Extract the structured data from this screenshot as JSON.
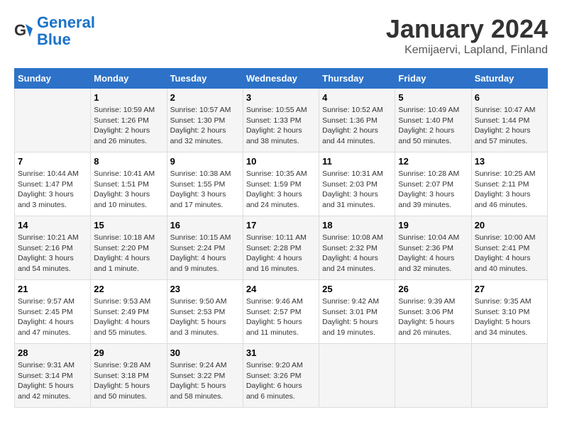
{
  "header": {
    "logo_general": "General",
    "logo_blue": "Blue",
    "main_title": "January 2024",
    "subtitle": "Kemijaervi, Lapland, Finland"
  },
  "weekdays": [
    "Sunday",
    "Monday",
    "Tuesday",
    "Wednesday",
    "Thursday",
    "Friday",
    "Saturday"
  ],
  "weeks": [
    [
      {
        "day": "",
        "info": ""
      },
      {
        "day": "1",
        "info": "Sunrise: 10:59 AM\nSunset: 1:26 PM\nDaylight: 2 hours\nand 26 minutes."
      },
      {
        "day": "2",
        "info": "Sunrise: 10:57 AM\nSunset: 1:30 PM\nDaylight: 2 hours\nand 32 minutes."
      },
      {
        "day": "3",
        "info": "Sunrise: 10:55 AM\nSunset: 1:33 PM\nDaylight: 2 hours\nand 38 minutes."
      },
      {
        "day": "4",
        "info": "Sunrise: 10:52 AM\nSunset: 1:36 PM\nDaylight: 2 hours\nand 44 minutes."
      },
      {
        "day": "5",
        "info": "Sunrise: 10:49 AM\nSunset: 1:40 PM\nDaylight: 2 hours\nand 50 minutes."
      },
      {
        "day": "6",
        "info": "Sunrise: 10:47 AM\nSunset: 1:44 PM\nDaylight: 2 hours\nand 57 minutes."
      }
    ],
    [
      {
        "day": "7",
        "info": "Sunrise: 10:44 AM\nSunset: 1:47 PM\nDaylight: 3 hours\nand 3 minutes."
      },
      {
        "day": "8",
        "info": "Sunrise: 10:41 AM\nSunset: 1:51 PM\nDaylight: 3 hours\nand 10 minutes."
      },
      {
        "day": "9",
        "info": "Sunrise: 10:38 AM\nSunset: 1:55 PM\nDaylight: 3 hours\nand 17 minutes."
      },
      {
        "day": "10",
        "info": "Sunrise: 10:35 AM\nSunset: 1:59 PM\nDaylight: 3 hours\nand 24 minutes."
      },
      {
        "day": "11",
        "info": "Sunrise: 10:31 AM\nSunset: 2:03 PM\nDaylight: 3 hours\nand 31 minutes."
      },
      {
        "day": "12",
        "info": "Sunrise: 10:28 AM\nSunset: 2:07 PM\nDaylight: 3 hours\nand 39 minutes."
      },
      {
        "day": "13",
        "info": "Sunrise: 10:25 AM\nSunset: 2:11 PM\nDaylight: 3 hours\nand 46 minutes."
      }
    ],
    [
      {
        "day": "14",
        "info": "Sunrise: 10:21 AM\nSunset: 2:16 PM\nDaylight: 3 hours\nand 54 minutes."
      },
      {
        "day": "15",
        "info": "Sunrise: 10:18 AM\nSunset: 2:20 PM\nDaylight: 4 hours\nand 1 minute."
      },
      {
        "day": "16",
        "info": "Sunrise: 10:15 AM\nSunset: 2:24 PM\nDaylight: 4 hours\nand 9 minutes."
      },
      {
        "day": "17",
        "info": "Sunrise: 10:11 AM\nSunset: 2:28 PM\nDaylight: 4 hours\nand 16 minutes."
      },
      {
        "day": "18",
        "info": "Sunrise: 10:08 AM\nSunset: 2:32 PM\nDaylight: 4 hours\nand 24 minutes."
      },
      {
        "day": "19",
        "info": "Sunrise: 10:04 AM\nSunset: 2:36 PM\nDaylight: 4 hours\nand 32 minutes."
      },
      {
        "day": "20",
        "info": "Sunrise: 10:00 AM\nSunset: 2:41 PM\nDaylight: 4 hours\nand 40 minutes."
      }
    ],
    [
      {
        "day": "21",
        "info": "Sunrise: 9:57 AM\nSunset: 2:45 PM\nDaylight: 4 hours\nand 47 minutes."
      },
      {
        "day": "22",
        "info": "Sunrise: 9:53 AM\nSunset: 2:49 PM\nDaylight: 4 hours\nand 55 minutes."
      },
      {
        "day": "23",
        "info": "Sunrise: 9:50 AM\nSunset: 2:53 PM\nDaylight: 5 hours\nand 3 minutes."
      },
      {
        "day": "24",
        "info": "Sunrise: 9:46 AM\nSunset: 2:57 PM\nDaylight: 5 hours\nand 11 minutes."
      },
      {
        "day": "25",
        "info": "Sunrise: 9:42 AM\nSunset: 3:01 PM\nDaylight: 5 hours\nand 19 minutes."
      },
      {
        "day": "26",
        "info": "Sunrise: 9:39 AM\nSunset: 3:06 PM\nDaylight: 5 hours\nand 26 minutes."
      },
      {
        "day": "27",
        "info": "Sunrise: 9:35 AM\nSunset: 3:10 PM\nDaylight: 5 hours\nand 34 minutes."
      }
    ],
    [
      {
        "day": "28",
        "info": "Sunrise: 9:31 AM\nSunset: 3:14 PM\nDaylight: 5 hours\nand 42 minutes."
      },
      {
        "day": "29",
        "info": "Sunrise: 9:28 AM\nSunset: 3:18 PM\nDaylight: 5 hours\nand 50 minutes."
      },
      {
        "day": "30",
        "info": "Sunrise: 9:24 AM\nSunset: 3:22 PM\nDaylight: 5 hours\nand 58 minutes."
      },
      {
        "day": "31",
        "info": "Sunrise: 9:20 AM\nSunset: 3:26 PM\nDaylight: 6 hours\nand 6 minutes."
      },
      {
        "day": "",
        "info": ""
      },
      {
        "day": "",
        "info": ""
      },
      {
        "day": "",
        "info": ""
      }
    ]
  ]
}
